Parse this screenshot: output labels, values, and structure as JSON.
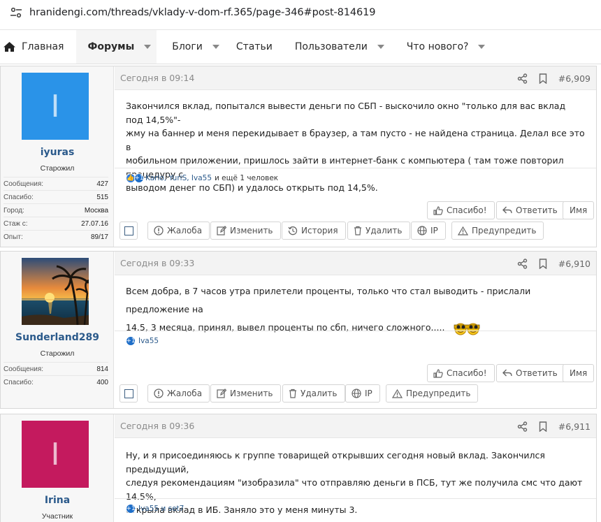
{
  "browser": {
    "url": "hranidengi.com/threads/vklady-v-dom-rf.365/page-346#post-814619"
  },
  "nav": {
    "home": "Главная",
    "forums": "Форумы",
    "blogs": "Блоги",
    "articles": "Статьи",
    "users": "Пользователи",
    "whats_new": "Что нового?"
  },
  "colors": {
    "link": "#2b5a8b",
    "avatar_iyuras": "#2a93e8",
    "avatar_irina": "#c41a5e"
  },
  "labels": {
    "like": "Спасибо!",
    "reply": "Ответить",
    "name": "Имя",
    "report": "Жалоба",
    "edit": "Изменить",
    "history": "История",
    "delete": "Удалить",
    "ip": "IP",
    "warn": "Предупредить"
  },
  "posts": [
    {
      "avatar_letter": "I",
      "username": "iyuras",
      "title": "Старожил",
      "stats": [
        {
          "k": "Сообщения:",
          "v": "427"
        },
        {
          "k": "Спасибо:",
          "v": "515"
        },
        {
          "k": "Город:",
          "v": "Москва"
        },
        {
          "k": "Стаж с:",
          "v": "27.07.16"
        },
        {
          "k": "Опыт:",
          "v": "89/17"
        }
      ],
      "time": "Сегодня в 09:14",
      "number": "#6,909",
      "lines": [
        "Закончился вклад, попытался вывести деньги по СБП - выскочило окно \"только для вас вклад под 14,5%\"-",
        "жму на баннер и меня перекидывает в браузер, а там пусто - не найдена страница. Делал все это в",
        "мобильном приложении, пришлось зайти в интернет-банк с компьютера ( там тоже повторил процедуру с",
        "выводом денег по СБП) и удалось открыть под 14,5%."
      ],
      "likes_names": "Karlo, YuriS, Iva55",
      "likes_rest": "и ещё 1 человек"
    },
    {
      "username": "Sunderland289",
      "title": "Старожил",
      "stats": [
        {
          "k": "Сообщения:",
          "v": "814"
        },
        {
          "k": "Спасибо:",
          "v": "400"
        }
      ],
      "time": "Сегодня в 09:33",
      "number": "#6,910",
      "lines": [
        "Всем добра, в 7 часов утра прилетели проценты, только что стал выводить - прислали предложение на",
        "14.5, 3 месяца, принял, вывел проценты по сбп, ничего сложного....."
      ],
      "likes_names": "Iva55"
    },
    {
      "avatar_letter": "I",
      "username": "Irina",
      "title": "Участник",
      "time": "Сегодня в 09:36",
      "number": "#6,911",
      "lines": [
        "Ну, и я присоединяюсь к группе товарищей открывших сегодня новый вклад. Закончился предыдущий,",
        "следуя рекомендациям \"изобразила\" что отправляю деньги в ПСБ, тут же получила смс что дают 14.5%,",
        "открыла вклад в ИБ. Заняло это у меня минуты 3."
      ],
      "likes_names": "Iva55 и set7"
    }
  ]
}
